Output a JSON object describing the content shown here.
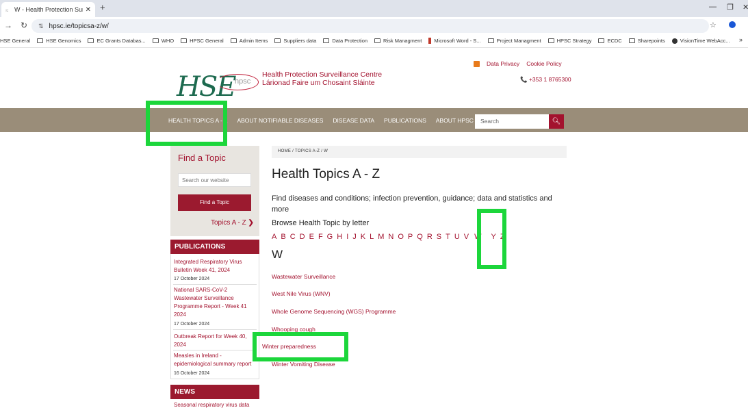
{
  "browser": {
    "tab_title": "W - Health Protection Surveilla",
    "url": "hpsc.ie/topicsa-z/w/",
    "bookmarks": [
      "HSE General",
      "HSE Genomics",
      "EC Grants Databas...",
      "WHO",
      "HPSC General",
      "Admin Items",
      "Suppliers data",
      "Data Protection",
      "Risk Managment",
      "Microsoft Word - S...",
      "Project Managment",
      "HPSC Strategy",
      "ECDC",
      "Sharepoints",
      "VisionTime WebAcc..."
    ],
    "more": "»"
  },
  "header": {
    "logo_text": "HSE",
    "logo_hpsc": "hpsc",
    "org_name": "Health Protection Surveillance Centre",
    "org_irish": "Lárionad Faire um Chosaint Sláinte",
    "data_privacy": "Data Privacy",
    "cookie_policy": "Cookie Policy",
    "phone": "+353 1 8765300"
  },
  "nav": {
    "items": [
      "HEALTH TOPICS A - Z",
      "ABOUT NOTIFIABLE DISEASES",
      "DISEASE DATA",
      "PUBLICATIONS",
      "ABOUT HPSC"
    ],
    "search_placeholder": "Search"
  },
  "sidebar": {
    "find_title": "Find a Topic",
    "search_placeholder": "Search our website",
    "find_button": "Find a Topic",
    "topics_link": "Topics A - Z",
    "publications_heading": "PUBLICATIONS",
    "publications": [
      {
        "title": "Integrated Respiratory Virus Bulletin Week 41, 2024",
        "date": "17 October 2024"
      },
      {
        "title": "National SARS-CoV-2 Wastewater Surveillance Programme Report - Week 41 2024",
        "date": "17 October 2024"
      },
      {
        "title": "Outbreak Report for Week 40, 2024",
        "date": ""
      },
      {
        "title": "Measles in Ireland - epidemiological summary report",
        "date": "16 October 2024"
      }
    ],
    "news_heading": "NEWS",
    "news_first": "Seasonal respiratory virus data"
  },
  "main": {
    "breadcrumb": "HOME  /  TOPICS A-Z  /  W",
    "title": "Health Topics A - Z",
    "intro": "Find diseases and conditions; infection prevention, guidance; data and statistics and more",
    "browse_label": "Browse Health Topic by letter",
    "letters": [
      "A",
      "B",
      "C",
      "D",
      "E",
      "F",
      "G",
      "H",
      "I",
      "J",
      "K",
      "L",
      "M",
      "N",
      "O",
      "P",
      "Q",
      "R",
      "S",
      "T",
      "U",
      "V",
      "W",
      "Y",
      "Z"
    ],
    "current_letter": "W",
    "topics": [
      "Wastewater Surveillance",
      "West Nile Virus (WNV)",
      "Whole Genome Sequencing (WGS) Programme",
      "Whooping cough",
      "Winter preparedness",
      "Winter Vomiting Disease"
    ]
  }
}
